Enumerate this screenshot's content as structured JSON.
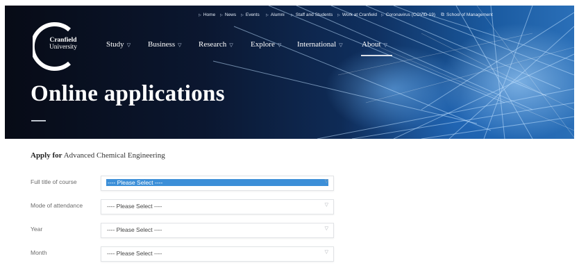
{
  "utility_nav": {
    "items": [
      "Home",
      "News",
      "Events",
      "Alumni",
      "Staff and Students",
      "Work at Cranfield",
      "Coronavirus (COVID-19)"
    ],
    "external": "School of Management"
  },
  "logo": {
    "line1": "Cranfield",
    "line2": "University"
  },
  "main_nav": {
    "items": [
      "Study",
      "Business",
      "Research",
      "Explore",
      "International",
      "About"
    ],
    "active": "About"
  },
  "page_title": "Online applications",
  "apply": {
    "prefix": "Apply for",
    "course": "Advanced Chemical Engineering"
  },
  "form": {
    "fields": [
      {
        "label": "Full title of course",
        "value": "---- Please Select ----",
        "highlighted": true
      },
      {
        "label": "Mode of attendance",
        "value": "---- Please Select ----",
        "highlighted": false
      },
      {
        "label": "Year",
        "value": "---- Please Select ----",
        "highlighted": false
      },
      {
        "label": "Month",
        "value": "---- Please Select ----",
        "highlighted": false
      }
    ]
  },
  "colors": {
    "highlight": "#3c8fd8",
    "hero_dark": "#0b1730",
    "hero_light": "#2a6fb8"
  },
  "icons": {
    "nav_item": "triangle-right-icon",
    "external": "external-link-icon",
    "dropdown": "chevron-down-icon"
  }
}
